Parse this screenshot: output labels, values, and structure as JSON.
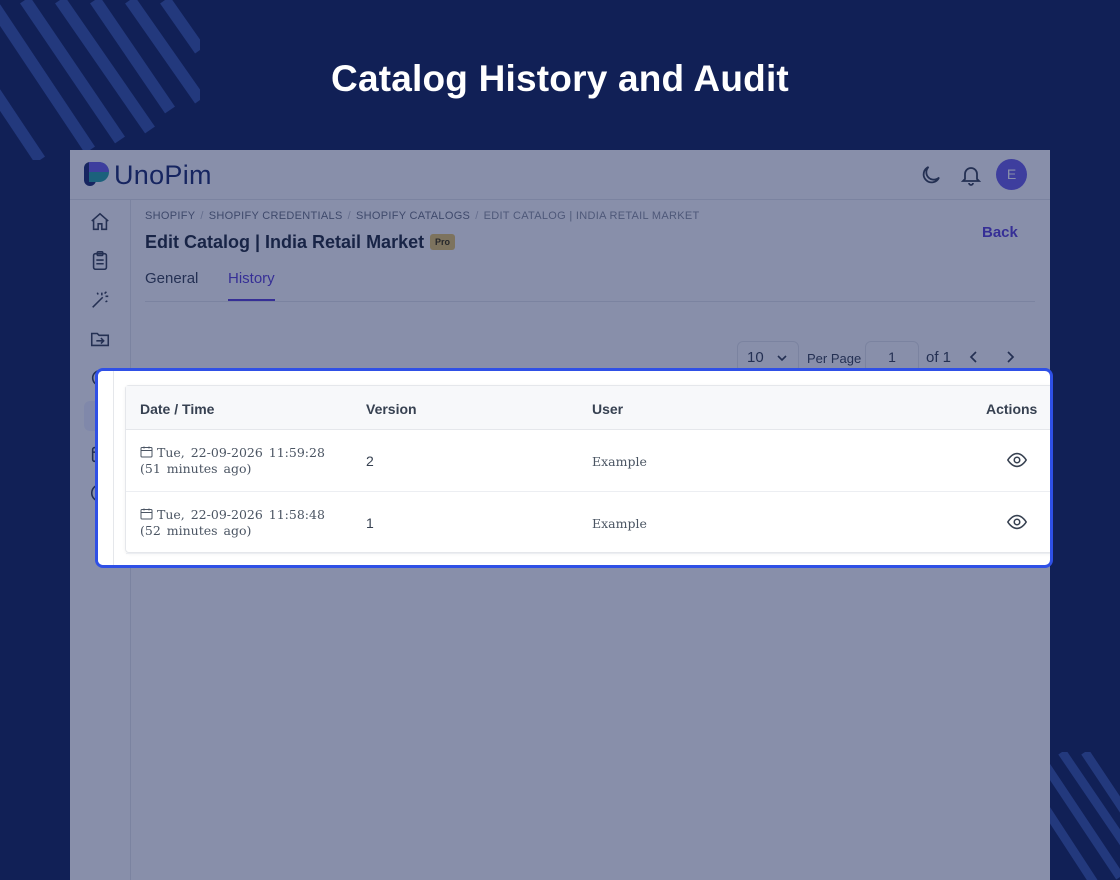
{
  "banner": {
    "title": "Catalog History and Audit"
  },
  "app": {
    "logo_text": "UnoPim",
    "avatar_initial": "E"
  },
  "breadcrumb": [
    "SHOPIFY",
    "SHOPIFY CREDENTIALS",
    "SHOPIFY CATALOGS",
    "EDIT CATALOG | INDIA RETAIL MARKET"
  ],
  "page": {
    "title": "Edit Catalog | India Retail Market",
    "badge": "Pro",
    "back_label": "Back"
  },
  "tabs": [
    {
      "label": "General",
      "active": false
    },
    {
      "label": "History",
      "active": true
    }
  ],
  "pagination": {
    "per_page_value": "10",
    "per_page_label": "Per Page",
    "page_value": "1",
    "of_label": "of 1"
  },
  "table": {
    "headers": [
      "Date / Time",
      "Version",
      "User",
      "Actions"
    ],
    "rows": [
      {
        "date": "Tue, 22-09-2026 11:59:28 (51 minutes ago)",
        "version": "2",
        "user": "Example"
      },
      {
        "date": "Tue, 22-09-2026 11:58:48 (52 minutes ago)",
        "version": "1",
        "user": "Example"
      }
    ]
  },
  "colors": {
    "background": "#112056",
    "accent": "#5b3fd6",
    "highlight_border": "#2f50e6",
    "badge": "#e8c766"
  },
  "icons": [
    "moon-icon",
    "bell-icon",
    "home-icon",
    "clipboard-icon",
    "magic-wand-icon",
    "folder-transfer-icon",
    "eye-icon",
    "calendar-icon",
    "chevron-down-icon",
    "chevron-left-icon",
    "chevron-right-icon"
  ]
}
